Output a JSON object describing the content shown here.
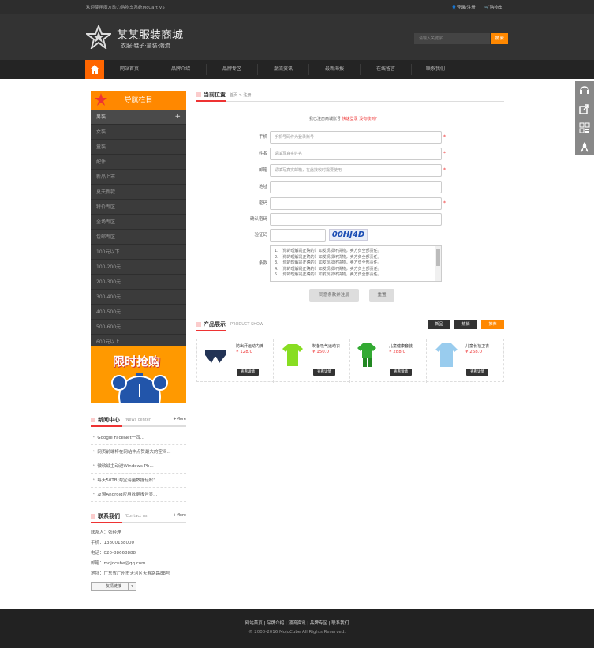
{
  "topbar": {
    "welcome": "欢迎使用魔方动力购物车系统McCart V5",
    "login": "登录/注册",
    "cart": "购物车"
  },
  "header": {
    "logo_title": "某某服装商城",
    "logo_sub": "衣服·鞋子·童装·潮流",
    "search_placeholder": "请输入关键字",
    "search_btn": "搜 索"
  },
  "nav": {
    "items": [
      "网站首页",
      "品牌介绍",
      "品牌专区",
      "潮流资讯",
      "最新海报",
      "在线留言",
      "联系我们"
    ]
  },
  "sidebar": {
    "title": "导航栏目",
    "items": [
      "男装",
      "女装",
      "童装",
      "配件",
      "新品上市",
      "夏天新款",
      "特价专区",
      "全场专区",
      "包邮专区",
      "100元以下",
      "100-200元",
      "200-300元",
      "300-400元",
      "400-500元",
      "500-600元",
      "600元以上"
    ],
    "promo": "限时抢购"
  },
  "news": {
    "title": "新闻中心",
    "sub": "/News center",
    "more": "+More",
    "items": [
      "Google FaceNet一四...",
      "网页前端将在网站中点赞最大的空间...",
      "微软战主动进Windows Ph...",
      "每天50TB 淘宝海量数据轻松“...",
      "友盟Android应用数据报告显..."
    ]
  },
  "contact": {
    "title": "联系我们",
    "sub": "/Contact us",
    "more": "+More",
    "lines": [
      "联系人：张经理",
      "手机：13800138000",
      "电话：020-88668888",
      "邮箱：mojocube@qq.com",
      "地址：广东省广州市天河区天寿路路88号"
    ],
    "links_btn": "友情链接"
  },
  "main": {
    "position_title": "当前位置",
    "breadcrumb": "首页 > 注册",
    "notice": "我已注册商城账号",
    "login_link": "快速登录",
    "login_link2": "没有收到？",
    "form": {
      "phone_label": "手机",
      "phone_ph": "手机号码作为登录账号",
      "name_label": "姓名",
      "name_ph": "请填写真实姓名",
      "email_label": "邮箱",
      "email_ph": "请填写真实邮箱，在此接收时需要使用",
      "address_label": "地址",
      "pwd_label": "密码",
      "pwd2_label": "确认密码",
      "code_label": "验证码",
      "code_value": "00HJ4D",
      "terms_label": "条款",
      "terms": [
        "1、（你的理解是正确的）如发现损坏货物，卖方负全部责任。",
        "2、（你的理解是正确的）如发现损坏货物，卖方负全部责任。",
        "3、（你的理解是正确的）如发现损坏货物，卖方负全部责任。",
        "4、（你的理解是正确的）如发现损坏货物，卖方负全部责任。",
        "5、（你的理解是正确的）如发现损坏货物，卖方负全部责任。"
      ],
      "agree_btn": "同意条款并注册",
      "reset_btn": "重置"
    },
    "products": {
      "title": "产品展示",
      "sub": "PRODUCT SHOW",
      "tabs": [
        "新品",
        "热销",
        "推荐"
      ],
      "detail": "查看详情",
      "items": [
        {
          "name": "防出汗运动内裤",
          "price": "¥ 128.0"
        },
        {
          "name": "制备吸气运动衣",
          "price": "¥ 150.0"
        },
        {
          "name": "儿童健康套装",
          "price": "¥ 288.0"
        },
        {
          "name": "儿童长袖卫衣",
          "price": "¥ 268.0"
        }
      ]
    }
  },
  "footer": {
    "links": [
      "网站首页",
      "品牌介绍",
      "潮流资讯",
      "品牌专区",
      "联系我们"
    ],
    "copyright": "© 2000-2016 MojoCube All Rights Reserved."
  },
  "colors": {
    "accent": "#ff6600",
    "orange": "#ff8800",
    "dark": "#333333",
    "red": "#ee3333"
  }
}
